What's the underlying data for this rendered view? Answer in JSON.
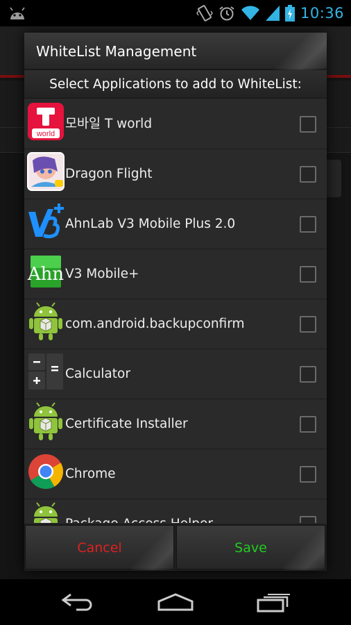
{
  "status_bar": {
    "time": "10:36",
    "icons": [
      "android-icon",
      "vibrate-icon",
      "alarm-icon",
      "wifi-icon",
      "signal-icon",
      "battery-charging-icon"
    ],
    "accent": "#33b5e5"
  },
  "dialog": {
    "title": "WhiteList Management",
    "subtitle": "Select Applications to add to WhiteList:",
    "apps": [
      {
        "name": "모바일 T world",
        "icon": "t-world-icon",
        "checked": false
      },
      {
        "name": "Dragon Flight",
        "icon": "dragon-flight-icon",
        "checked": false
      },
      {
        "name": "AhnLab V3 Mobile Plus 2.0",
        "icon": "v3-plus-icon",
        "checked": false
      },
      {
        "name": "V3 Mobile+",
        "icon": "ahn-icon",
        "checked": false
      },
      {
        "name": "com.android.backupconfirm",
        "icon": "android-package-icon",
        "checked": false
      },
      {
        "name": "Calculator",
        "icon": "calculator-icon",
        "checked": false
      },
      {
        "name": "Certificate Installer",
        "icon": "android-package-icon",
        "checked": false
      },
      {
        "name": "Chrome",
        "icon": "chrome-icon",
        "checked": false
      },
      {
        "name": "Package Access Helper",
        "icon": "android-package-icon",
        "checked": false
      }
    ],
    "buttons": {
      "cancel": "Cancel",
      "save": "Save",
      "cancel_color": "#e02020",
      "save_color": "#22cc22"
    }
  },
  "nav_bar": {
    "icons": [
      "back-icon",
      "home-icon",
      "recent-apps-icon"
    ]
  }
}
